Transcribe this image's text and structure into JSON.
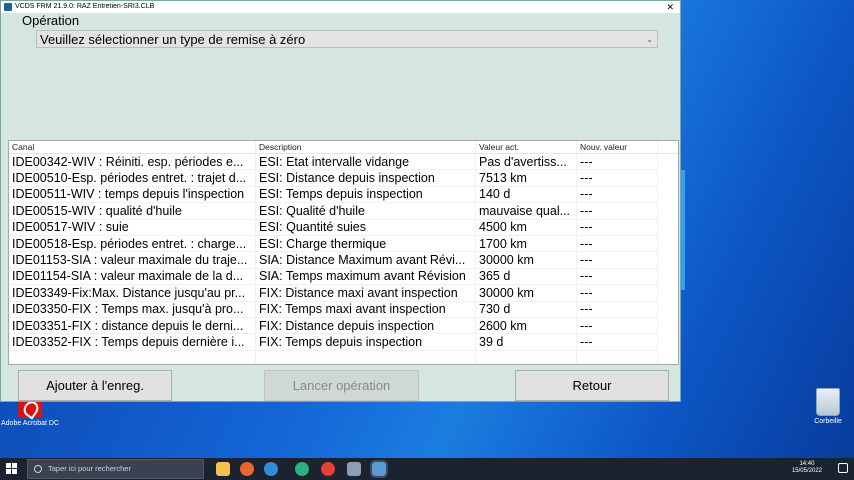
{
  "window": {
    "title": "VCDS FRM 21.9.0:  RAZ Entretien-SRI3.CLB",
    "close_glyph": "✕"
  },
  "operation": {
    "label": "Opération",
    "select_value": "Veuillez sélectionner un type de remise à zéro"
  },
  "table": {
    "headers": [
      "Canal",
      "Description",
      "Valeur act.",
      "Nouv. valeur"
    ],
    "rows": [
      [
        "IDE00342-WIV : Réiniti. esp. périodes e...",
        "ESI: Etat intervalle vidange",
        "Pas d'avertiss...",
        "---"
      ],
      [
        "IDE00510-Esp. périodes entret. : trajet d...",
        "ESI: Distance depuis inspection",
        "7513 km",
        "---"
      ],
      [
        "IDE00511-WIV : temps depuis l'inspection",
        "ESI: Temps depuis inspection",
        "140 d",
        "---"
      ],
      [
        "IDE00515-WIV : qualité d'huile",
        "ESI: Qualité d'huile",
        "mauvaise qual...",
        "---"
      ],
      [
        "IDE00517-WIV : suie",
        "ESI: Quantité suies",
        "4500 km",
        "---"
      ],
      [
        "IDE00518-Esp. périodes entret. : charge...",
        "ESI: Charge thermique",
        "1700 km",
        "---"
      ],
      [
        "IDE01153-SIA : valeur maximale du traje...",
        "SIA: Distance Maximum avant Révi...",
        "30000 km",
        "---"
      ],
      [
        "IDE01154-SIA : valeur maximale de la d...",
        "SIA: Temps maximum avant Révision",
        "365 d",
        "---"
      ],
      [
        "IDE03349-Fix:Max. Distance jusqu'au pr...",
        "FIX: Distance maxi avant inspection",
        "30000 km",
        "---"
      ],
      [
        "IDE03350-FIX : Temps max. jusqu'à pro...",
        "FIX: Temps maxi avant inspection",
        "730 d",
        "---"
      ],
      [
        "IDE03351-FIX : distance depuis le derni...",
        "FIX: Distance depuis inspection",
        "2600 km",
        "---"
      ],
      [
        "IDE03352-FIX : Temps depuis dernière i...",
        "FIX: Temps depuis inspection",
        "39 d",
        "---"
      ]
    ]
  },
  "buttons": {
    "add": "Ajouter à l'enreg.",
    "launch": "Lancer opération",
    "back": "Retour"
  },
  "desktop": {
    "acrobat_label": "Adobe Acrobat DC",
    "bin_label": "Corbeille"
  },
  "taskbar": {
    "search_placeholder": "Taper ici pour rechercher",
    "time": "14:40",
    "date": "15/05/2022",
    "icons": [
      "file-explorer-icon",
      "firefox-icon",
      "edge-icon",
      "edge-beta-icon",
      "chrome-icon",
      "tool-icon",
      "vcds-icon"
    ]
  }
}
